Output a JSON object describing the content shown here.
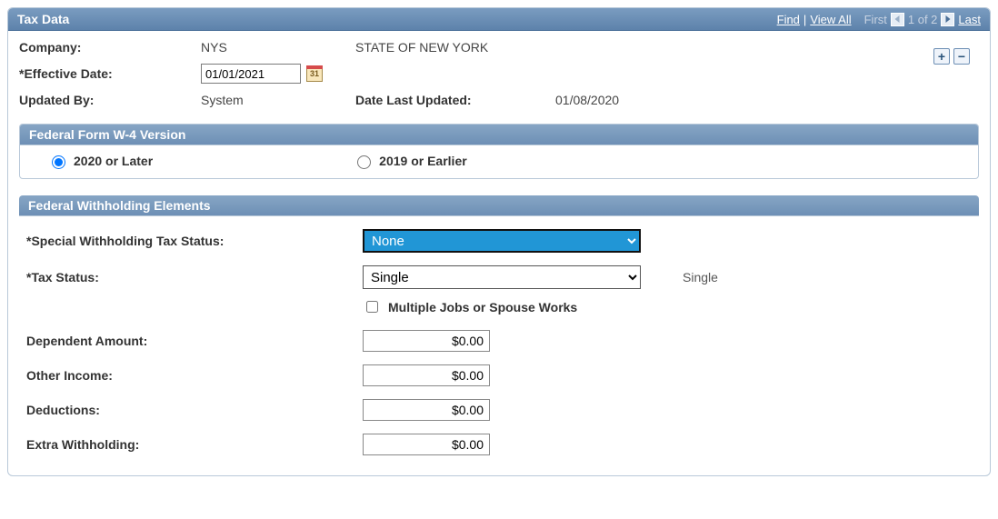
{
  "header": {
    "title": "Tax Data",
    "nav": {
      "find": "Find",
      "view_all": "View All",
      "first": "First",
      "counter": "1 of 2",
      "last": "Last"
    }
  },
  "toolbar": {
    "add": "+",
    "remove": "−"
  },
  "company": {
    "label": "Company:",
    "code": "NYS",
    "name": "STATE OF NEW YORK"
  },
  "effective_date": {
    "label": "*Effective Date:",
    "value": "01/01/2021"
  },
  "updated": {
    "by_label": "Updated By:",
    "by_value": "System",
    "last_label": "Date Last Updated:",
    "last_value": "01/08/2020"
  },
  "w4": {
    "panel_title": "Federal Form W-4 Version",
    "opt_2020": "2020 or Later",
    "opt_2019": "2019 or Earlier",
    "selected": "2020"
  },
  "withholding": {
    "panel_title": "Federal Withholding Elements",
    "special_label": "*Special Withholding Tax Status:",
    "special_value": "None",
    "tax_label": "*Tax Status:",
    "tax_value": "Single",
    "tax_aux": "Single",
    "multiple_jobs_label": "Multiple Jobs or Spouse Works",
    "multiple_jobs_checked": false,
    "dependent_label": "Dependent Amount:",
    "dependent_value": "$0.00",
    "other_income_label": "Other Income:",
    "other_income_value": "$0.00",
    "deductions_label": "Deductions:",
    "deductions_value": "$0.00",
    "extra_label": "Extra Withholding:",
    "extra_value": "$0.00"
  },
  "calendar_day": "31"
}
